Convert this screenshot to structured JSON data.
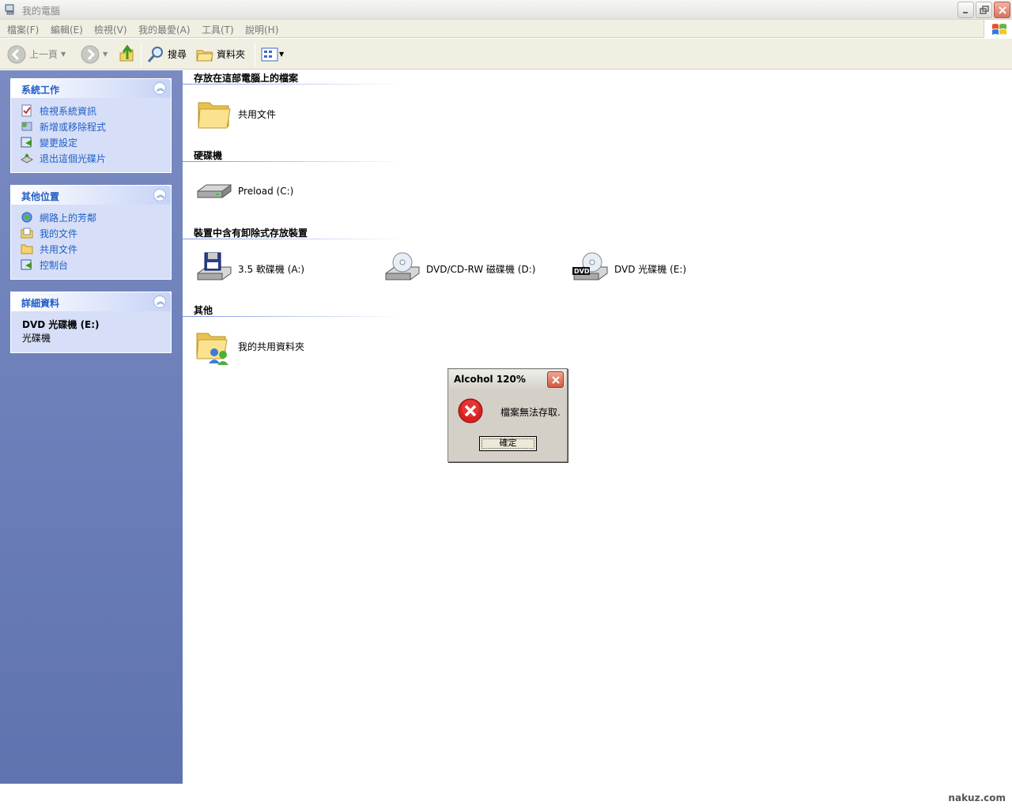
{
  "window": {
    "title": "我的電腦"
  },
  "menu": [
    "檔案(F)",
    "編輯(E)",
    "檢視(V)",
    "我的最愛(A)",
    "工具(T)",
    "說明(H)"
  ],
  "toolbar": {
    "back_label": "上一頁",
    "search_label": "搜尋",
    "folders_label": "資料夾"
  },
  "sidebar": {
    "system_tasks": {
      "title": "系統工作",
      "items": [
        "檢視系統資訊",
        "新增或移除程式",
        "變更設定",
        "退出這個光碟片"
      ]
    },
    "other_places": {
      "title": "其他位置",
      "items": [
        "網路上的芳鄰",
        "我的文件",
        "共用文件",
        "控制台"
      ]
    },
    "details": {
      "title": "詳細資料",
      "name": "DVD 光碟機 (E:)",
      "type": "光碟機"
    }
  },
  "main": {
    "groups": [
      {
        "header": "存放在這部電腦上的檔案",
        "items": [
          "共用文件"
        ]
      },
      {
        "header": "硬碟機",
        "items": [
          "Preload (C:)"
        ]
      },
      {
        "header": "裝置中含有卸除式存放裝置",
        "items": [
          "3.5 軟碟機 (A:)",
          "DVD/CD-RW 磁碟機 (D:)",
          "DVD 光碟機 (E:)"
        ]
      },
      {
        "header": "其他",
        "items": [
          "我的共用資料夾"
        ]
      }
    ]
  },
  "dialog": {
    "title": "Alcohol 120%",
    "message": "檔案無法存取.",
    "ok_label": "確定"
  },
  "watermark": "nakuz.com",
  "colors": {
    "link": "#215dc6",
    "taskpane": "#6b7fbd",
    "dialog_bg": "#d4d0c8"
  }
}
